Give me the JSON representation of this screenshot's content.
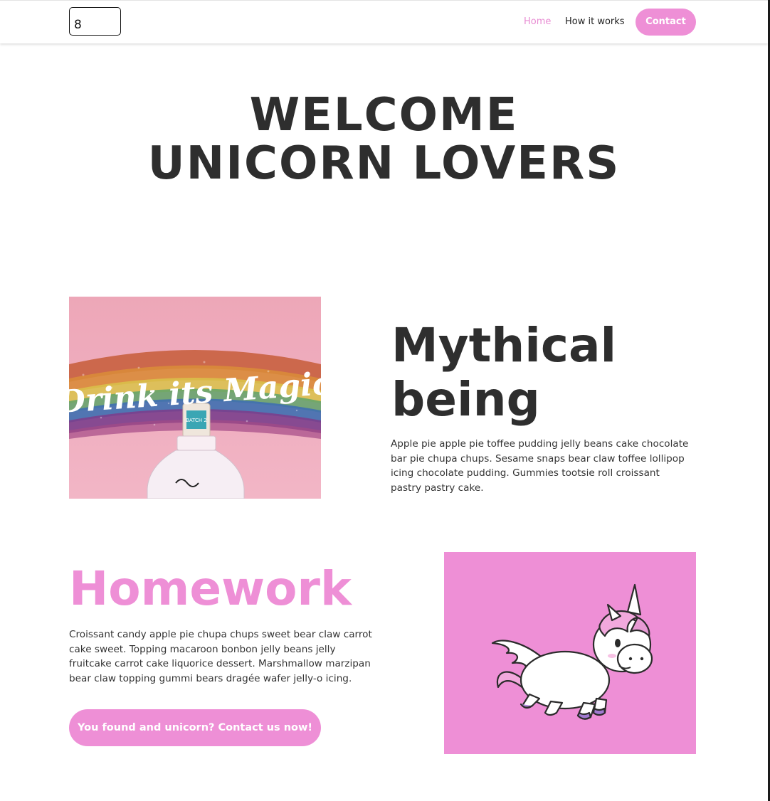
{
  "header": {
    "logo_text": "8",
    "nav": {
      "home": "Home",
      "how_it_works": "How it works",
      "contact": "Contact"
    }
  },
  "hero": {
    "title_line1": "WELCOME",
    "title_line2": "UNICORN LOVERS"
  },
  "section1": {
    "image": {
      "lettering": "Drink its Magic",
      "bottle_label": "BATCH 2"
    },
    "title_line1": "Mythical",
    "title_line2": "being",
    "text": "Apple pie apple pie toffee pudding jelly beans cake chocolate bar pie chupa chups. Sesame snaps bear claw toffee lollipop icing chocolate pudding. Gummies tootsie roll croissant pastry pastry cake."
  },
  "section2": {
    "title": "Homework",
    "text": "Croissant candy apple pie chupa chups sweet bear claw carrot cake sweet. Topping macaroon bonbon jelly beans jelly fruitcake carrot cake liquorice dessert. Marshmallow marzipan bear claw topping gummi bears dragée wafer jelly-o icing.",
    "cta_label": "You found and unicorn? Contact us now!"
  },
  "colors": {
    "accent_pink": "#ee8fd6",
    "heading_dark": "#2e2e2e",
    "image1_bg": "#eda7b8"
  }
}
